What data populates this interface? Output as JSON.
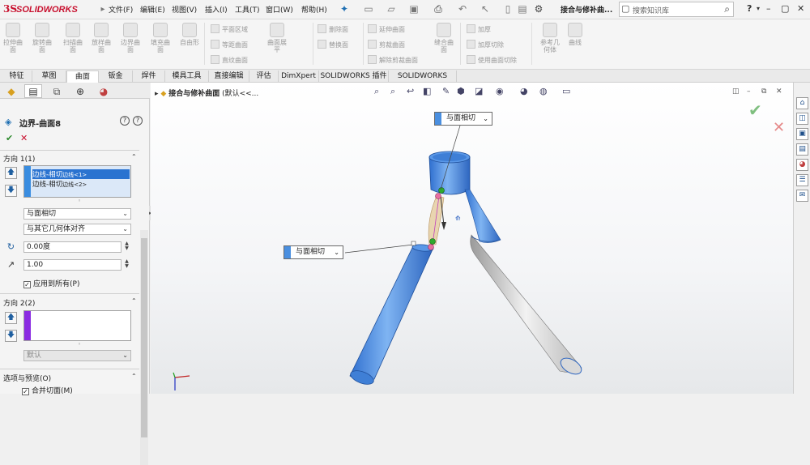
{
  "app": {
    "logo_prefix": "3S",
    "logo_text": "SOLIDWORKS",
    "document_title": "接合与修补曲...",
    "search_placeholder": "搜索知识库"
  },
  "menu": [
    "文件(F)",
    "编辑(E)",
    "视图(V)",
    "插入(I)",
    "工具(T)",
    "窗口(W)",
    "帮助(H)"
  ],
  "ribbon": {
    "big_tools": [
      {
        "label": "拉伸曲\n面"
      },
      {
        "label": "旋转曲\n面"
      },
      {
        "label": "扫描曲\n面"
      },
      {
        "label": "放样曲\n面"
      },
      {
        "label": "边界曲\n面"
      },
      {
        "label": "填充曲\n面"
      },
      {
        "label": "自由形"
      }
    ],
    "group2": [
      "平面区域",
      "等距曲面",
      "直纹曲面"
    ],
    "cut_surface": "曲面展\n平",
    "group3": [
      "删除面",
      "替换面"
    ],
    "group4": [
      "延伸曲面",
      "剪裁曲面",
      "解除剪裁曲面"
    ],
    "knit": "缝合曲\n面",
    "group5": [
      "加厚",
      "加厚切除",
      "使用曲面切除"
    ],
    "ref_geom": "参考几\n何体",
    "curves": "曲线"
  },
  "tabs": [
    "特征",
    "草图",
    "曲面",
    "钣金",
    "焊件",
    "模具工具",
    "直接编辑",
    "评估",
    "DimXpert",
    "SOLIDWORKS 插件",
    "SOLIDWORKS MBD"
  ],
  "active_tab": "曲面",
  "property_manager": {
    "title": "边界-曲面8",
    "direction1": {
      "header": "方向 1(1)",
      "items": [
        "边线<1>",
        "边线<2>"
      ],
      "item_prefix_1": "边线-相切",
      "item_prefix_2": "边线-相切",
      "tangency": "与面相切",
      "alignment": "与其它几何体对齐",
      "angle": "0.00度",
      "influence": "1.00",
      "apply_all": "应用到所有(P)"
    },
    "direction2": {
      "header": "方向 2(2)",
      "tangency": "默认"
    },
    "options": {
      "header": "选项与预览(O)",
      "merge": "合并切面(M)"
    }
  },
  "viewport": {
    "breadcrumb_bold": "接合与修补曲面",
    "breadcrumb_rest": "(默认<<...",
    "callout_top": "与面相切",
    "callout_left": "与面相切",
    "colors": {
      "surface_blue": "#4a90e2",
      "surface_gray": "#c8c8c8",
      "accent": "#4a8fe0"
    }
  }
}
